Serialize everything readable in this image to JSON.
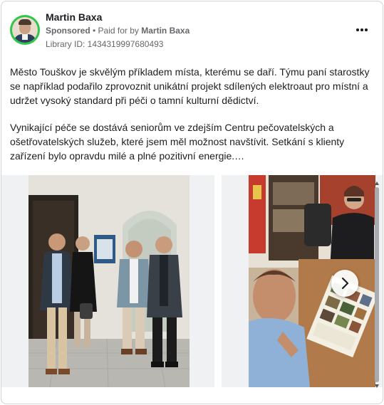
{
  "post": {
    "author_name": "Martin Baxa",
    "sponsored_label": "Sponsored",
    "separator": " • ",
    "paid_for_prefix": "Paid for by ",
    "paid_for_name": "Martin Baxa",
    "library_id": "Library ID: 1434319997680493",
    "paragraphs": [
      "Město Touškov je skvělým příkladem místa, kterému se daří. Týmu paní starostky se například podařilo zprovoznit unikátní projekt sdílených elektroaut pro místní a udržet vysoký standard při péči o tamní kulturní dědictví.",
      "Vynikající péče se dostává seniorům ve zdejším Centru pečovatelských a ošetřovatelských služeb, které jsem měl možnost navštívit. Setkání s klienty zařízení bylo opravdu milé a plné pozitivní energie.…"
    ]
  },
  "icons": {
    "more": "more-options-icon",
    "next": "chevron-right-icon",
    "avatar_ring_color": "#2fc64a"
  }
}
